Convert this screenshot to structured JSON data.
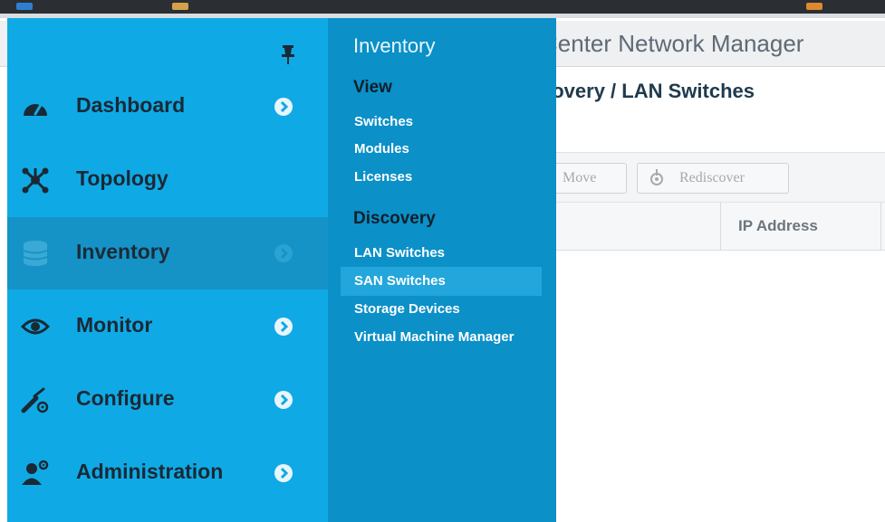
{
  "app": {
    "title": "Center Network Manager",
    "page_title": "covery / LAN Switches"
  },
  "toolbar": {
    "move_label": "Move",
    "rediscover_label": "Rediscover"
  },
  "table": {
    "columns": [
      "IP Address"
    ]
  },
  "nav": {
    "items": [
      {
        "label": "Dashboard",
        "icon": "dashboard-icon",
        "active": false
      },
      {
        "label": "Topology",
        "icon": "topology-icon",
        "active": false
      },
      {
        "label": "Inventory",
        "icon": "database-icon",
        "active": true
      },
      {
        "label": "Monitor",
        "icon": "eye-icon",
        "active": false
      },
      {
        "label": "Configure",
        "icon": "wrench-icon",
        "active": false
      },
      {
        "label": "Administration",
        "icon": "user-gear-icon",
        "active": false
      }
    ]
  },
  "flyout": {
    "title": "Inventory",
    "sections": [
      {
        "heading": "View",
        "links": [
          "Switches",
          "Modules",
          "Licenses"
        ]
      },
      {
        "heading": "Discovery",
        "links": [
          "LAN Switches",
          "SAN Switches",
          "Storage Devices",
          "Virtual Machine Manager"
        ]
      }
    ],
    "selected": "SAN Switches"
  },
  "colors": {
    "nav_bg": "#0faae5",
    "nav_active_bg": "#1693c6",
    "flyout_bg": "#0b90c8",
    "flyout_selected_bg": "#23a6db"
  }
}
